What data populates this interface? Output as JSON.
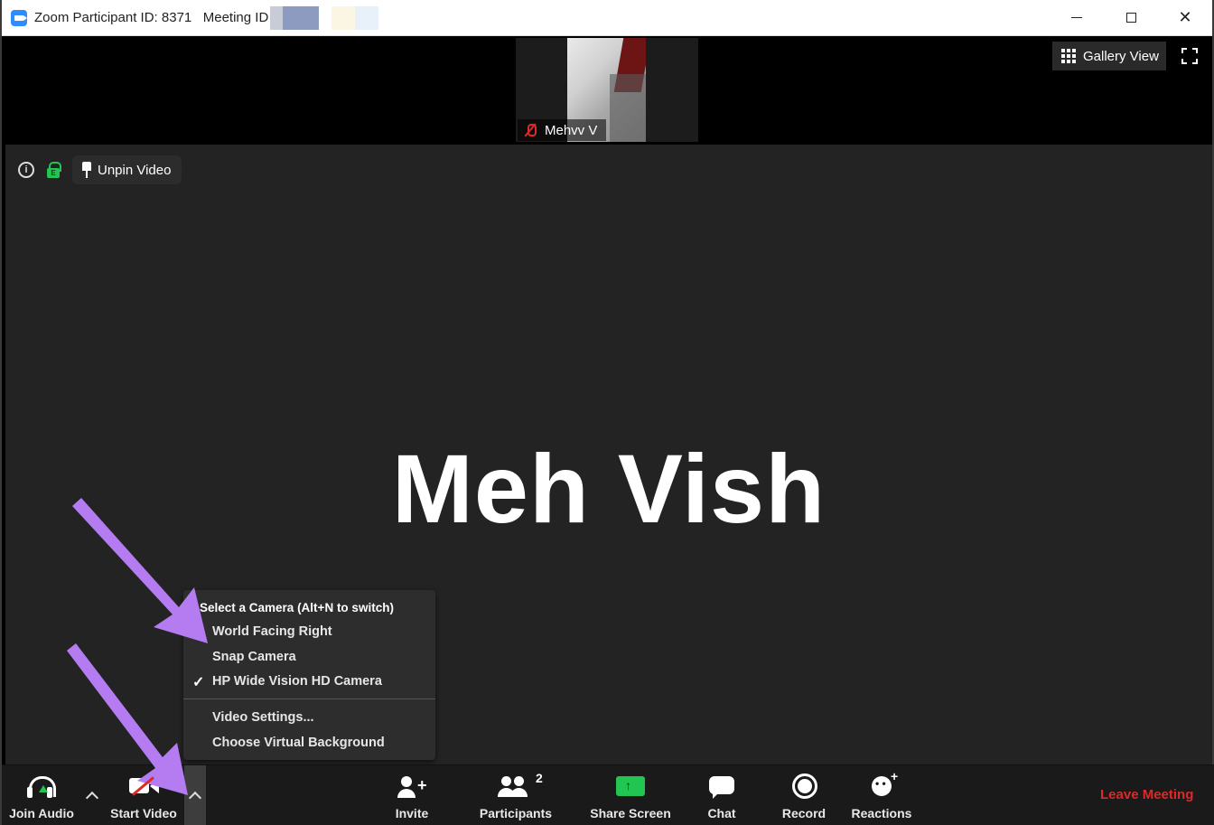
{
  "window": {
    "title": "Zoom Participant ID: 8371   Meeting ID",
    "controls": {
      "minimize": "minimize",
      "maximize": "maximize",
      "close": "✕"
    }
  },
  "top_strip": {
    "participant_name": "Mehvv V",
    "gallery_view_label": "Gallery View"
  },
  "stage": {
    "unpin_label": "Unpin Video",
    "info_glyph": "i",
    "speaker_name": "Meh Vish"
  },
  "camera_menu": {
    "header": "Select a Camera (Alt+N to switch)",
    "items": [
      "World Facing Right",
      "Snap Camera",
      "HP Wide Vision HD Camera"
    ],
    "selected_index": 2,
    "check_glyph": "✓",
    "extra_items": [
      "Video Settings...",
      "Choose Virtual Background"
    ]
  },
  "toolbar": {
    "join_audio": "Join Audio",
    "start_video": "Start Video",
    "invite": "Invite",
    "participants": "Participants",
    "participants_count": "2",
    "share_screen": "Share Screen",
    "chat": "Chat",
    "record": "Record",
    "reactions": "Reactions",
    "leave_meeting": "Leave Meeting"
  },
  "icons": {
    "app": "zoom-icon",
    "audio": "headphone-icon",
    "video": "video-off-icon",
    "invite": "add-user-icon",
    "participants": "people-icon",
    "share": "share-screen-icon",
    "chat": "chat-icon",
    "record": "record-icon",
    "reactions": "emoji-icon"
  },
  "colors": {
    "accent_green": "#23c552",
    "danger_red": "#e02828",
    "annotation_purple": "#b47cf0",
    "zoom_blue": "#2d8cff"
  }
}
